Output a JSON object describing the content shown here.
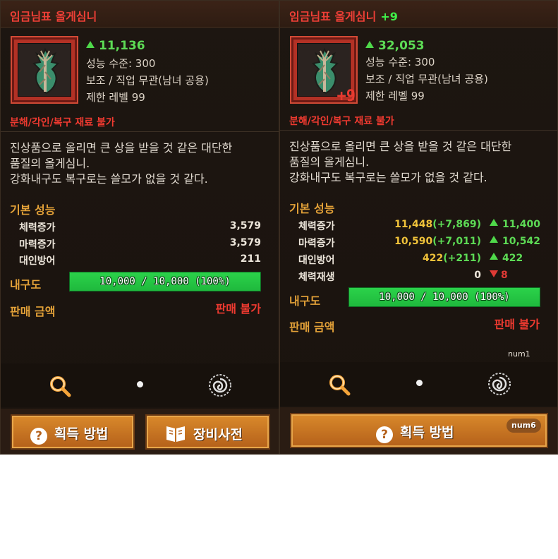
{
  "left": {
    "title": "임금님표 올게심니",
    "power": "11,136",
    "info_lines": [
      "성능 수준: 300",
      "보조 / 직업 무관(남녀 공용)",
      "제한 레벨 99"
    ],
    "warning": "분해/각인/복구 재료 불가",
    "description": [
      "진상품으로 올리면 큰 상을 받을 것 같은 대단한",
      "품질의 올게심니.",
      "강화내구도 복구로는 쓸모가 없을 것 같다."
    ],
    "basic_stats_title": "기본 성능",
    "stats": [
      {
        "name": "체력증가",
        "value": "3,579"
      },
      {
        "name": "마력증가",
        "value": "3,579"
      },
      {
        "name": "대인방어",
        "value": "211"
      }
    ],
    "durability_label": "내구도",
    "durability_text": "10,000 / 10,000 (100%)",
    "durability_ratio": 1.0,
    "sell_label": "판매 금액",
    "sell_value": "판매 불가",
    "buttons": {
      "obtain": "획득 방법",
      "dictionary": "장비사전"
    }
  },
  "right": {
    "title": "임금님표 올게심니",
    "title_plus": "+9",
    "enhance_badge": "+9",
    "power": "32,053",
    "info_lines": [
      "성능 수준: 300",
      "보조 / 직업 무관(남녀 공용)",
      "제한 레벨 99"
    ],
    "warning": "분해/각인/복구 재료 불가",
    "description": [
      "진상품으로 올리면 큰 상을 받을 것 같은 대단한",
      "품질의 올게심니.",
      "강화내구도 복구로는 쓸모가 없을 것 같다."
    ],
    "basic_stats_title": "기본 성능",
    "stats": [
      {
        "name": "체력증가",
        "total": "11,448",
        "bonus": "(+7,869)",
        "delta": "11,400",
        "dir": "up"
      },
      {
        "name": "마력증가",
        "total": "10,590",
        "bonus": "(+7,011)",
        "delta": "10,542",
        "dir": "up"
      },
      {
        "name": "대인방어",
        "total": "422",
        "bonus": "(+211)",
        "delta": "422",
        "dir": "up"
      },
      {
        "name": "체력재생",
        "total": "0",
        "bonus": "",
        "delta": "8",
        "dir": "down"
      }
    ],
    "durability_label": "내구도",
    "durability_text": "10,000 / 10,000 (100%)",
    "durability_ratio": 1.0,
    "sell_label": "판매 금액",
    "sell_value": "판매 불가",
    "num1": "num1",
    "num6": "num6",
    "buttons": {
      "obtain": "획득 방법"
    }
  },
  "icons": {
    "search": "magnifier-icon",
    "dot": "dot-icon",
    "swirl": "swirl-icon",
    "help": "question-icon",
    "book": "book-icon",
    "item": "leaf-item-icon"
  },
  "colors": {
    "title_red": "#ee3f36",
    "green_up": "#5ddb55",
    "section_orange": "#e3a138",
    "bar_green": "#2bd24a",
    "button_gold": "#d9892b"
  }
}
